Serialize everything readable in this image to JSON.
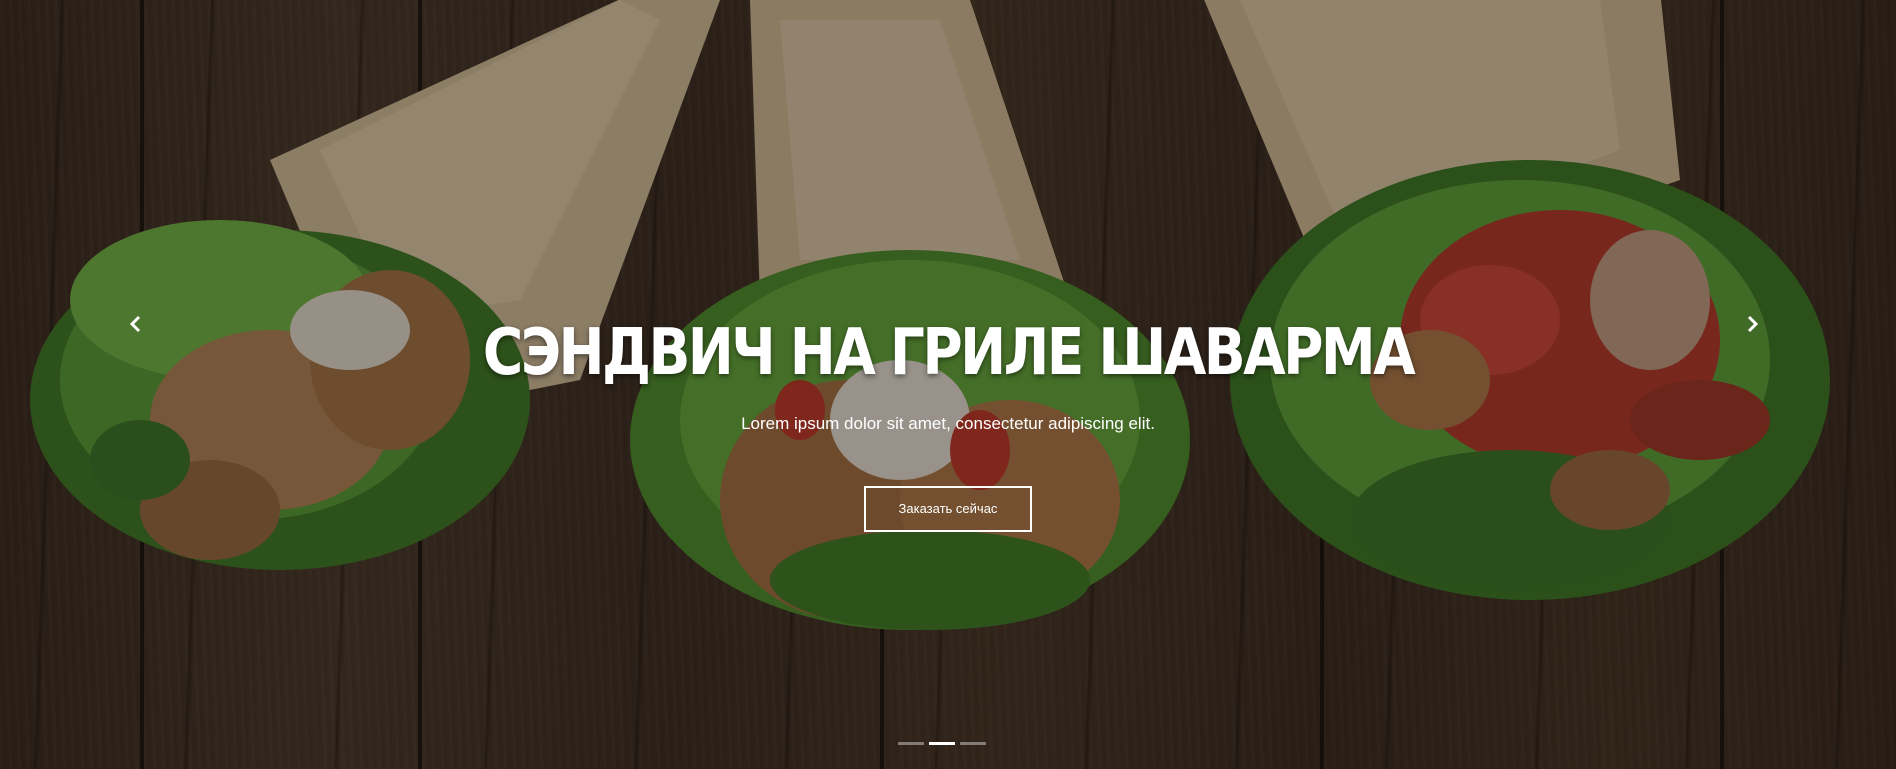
{
  "slider": {
    "title": "СЭНДВИЧ НА ГРИЛЕ ШАВАРМА",
    "subtitle": "Lorem ipsum dolor sit amet, consectetur adipiscing elit.",
    "cta_label": "Заказать сейчас",
    "prev_icon": "chevron-left-icon",
    "next_icon": "chevron-right-icon",
    "indicators": [
      {
        "active": false
      },
      {
        "active": true
      },
      {
        "active": false
      }
    ],
    "colors": {
      "text": "#ffffff",
      "indicator_active": "#ffffff",
      "indicator_inactive": "rgba(255,255,255,0.4)"
    }
  }
}
